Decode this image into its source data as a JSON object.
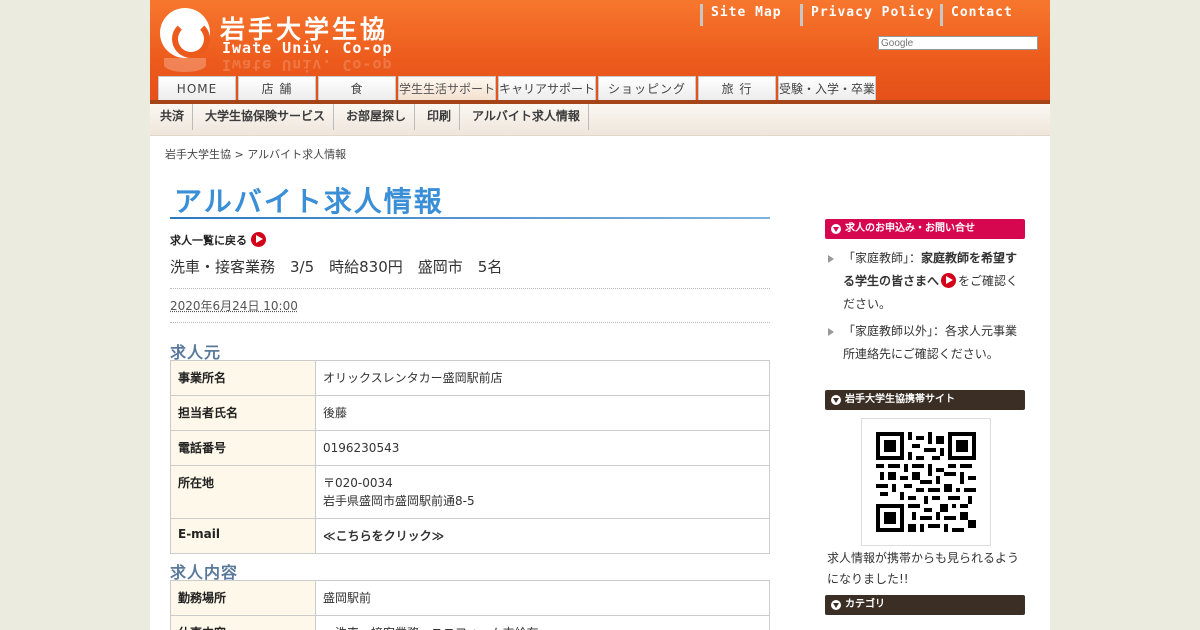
{
  "logo": {
    "name_jp": "岩手大学生協",
    "name_en": "Iwate Univ. Co-op"
  },
  "top_links": [
    "Site Map",
    "Privacy Policy",
    "Contact"
  ],
  "search": {
    "placeholder": "Google"
  },
  "main_nav": [
    "HOME",
    "店 舗",
    "食",
    "学生生活サポート",
    "キャリアサポート",
    "ショッピング",
    "旅 行",
    "受験・入学・卒業"
  ],
  "main_nav_active": "学生生活サポート",
  "sub_nav": [
    "共済",
    "大学生協保険サービス",
    "お部屋探し",
    "印刷",
    "アルバイト求人情報"
  ],
  "breadcrumb": "岩手大学生協 > アルバイト求人情報",
  "page_title": "アルバイト求人情報",
  "back_link": "求人一覧に戻る",
  "job_summary": "洗車・接客業務　3/5　時給830円　盛岡市　5名",
  "post_date": "2020年6月24日 10:00",
  "employer": {
    "title": "求人元",
    "rows": [
      {
        "label": "事業所名",
        "value": "オリックスレンタカー盛岡駅前店"
      },
      {
        "label": "担当者氏名",
        "value": "後藤"
      },
      {
        "label": "電話番号",
        "value": "0196230543"
      },
      {
        "label": "所在地",
        "value": "〒020-0034",
        "value2": "岩手県盛岡市盛岡駅前通8-5"
      },
      {
        "label": "E-mail",
        "value": "≪こちらをクリック≫"
      }
    ]
  },
  "job": {
    "title": "求人内容",
    "rows": [
      {
        "label": "勤務場所",
        "value": "盛岡駅前"
      },
      {
        "label": "仕事内容",
        "value": "・洗車・接客業務・ユニフォーム支給有"
      }
    ]
  },
  "sidebar": {
    "apply_head": "求人のお申込み・お問い合せ",
    "item1_prefix": "「家庭教師」：",
    "item1_bold": "家庭教師を希望する学生の皆さまへ",
    "item1_suffix": "をご確認ください。",
    "item2": "「家庭教師以外」：各求人元事業所連絡先にご確認ください。",
    "mobile_head": "岩手大学生協携帯サイト",
    "qr_caption": "求人情報が携帯からも見られるようになりました!!",
    "category_head": "カテゴリ"
  },
  "colors": {
    "header_orange": "#ec5a1c",
    "title_blue": "#3a8fd6",
    "apply_head_bg": "#d6074f",
    "dark_head_bg": "#3b2f25",
    "arrow_red": "#d3001a"
  }
}
